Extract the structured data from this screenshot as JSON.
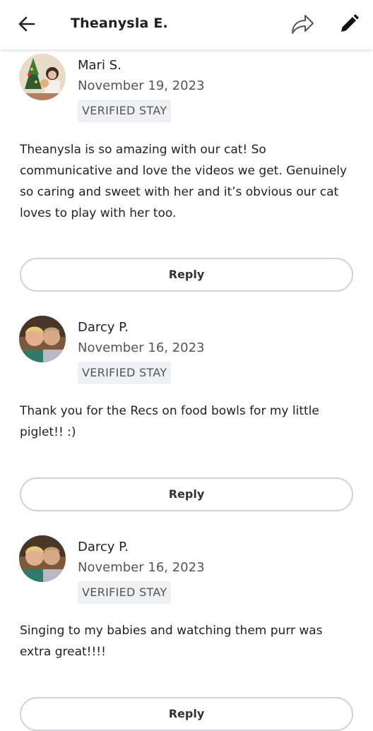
{
  "header": {
    "title": "Theanysla E."
  },
  "reviews": [
    {
      "name": "Mari S.",
      "date": "November 19, 2023",
      "badge": "VERIFIED STAY",
      "text": "Theanysla is so amazing with our cat! So communicative and love the videos we get. Genuinely so caring and sweet with her and it’s obvious our cat loves to play with her too.",
      "reply_label": "Reply"
    },
    {
      "name": "Darcy P.",
      "date": "November 16, 2023",
      "badge": "VERIFIED STAY",
      "text": "Thank you for the Recs on food bowls for my little piglet!! :)",
      "reply_label": "Reply"
    },
    {
      "name": "Darcy P.",
      "date": "November 16, 2023",
      "badge": "VERIFIED STAY",
      "text": "Singing to my babies and watching them purr was extra great!!!!",
      "reply_label": "Reply"
    }
  ]
}
